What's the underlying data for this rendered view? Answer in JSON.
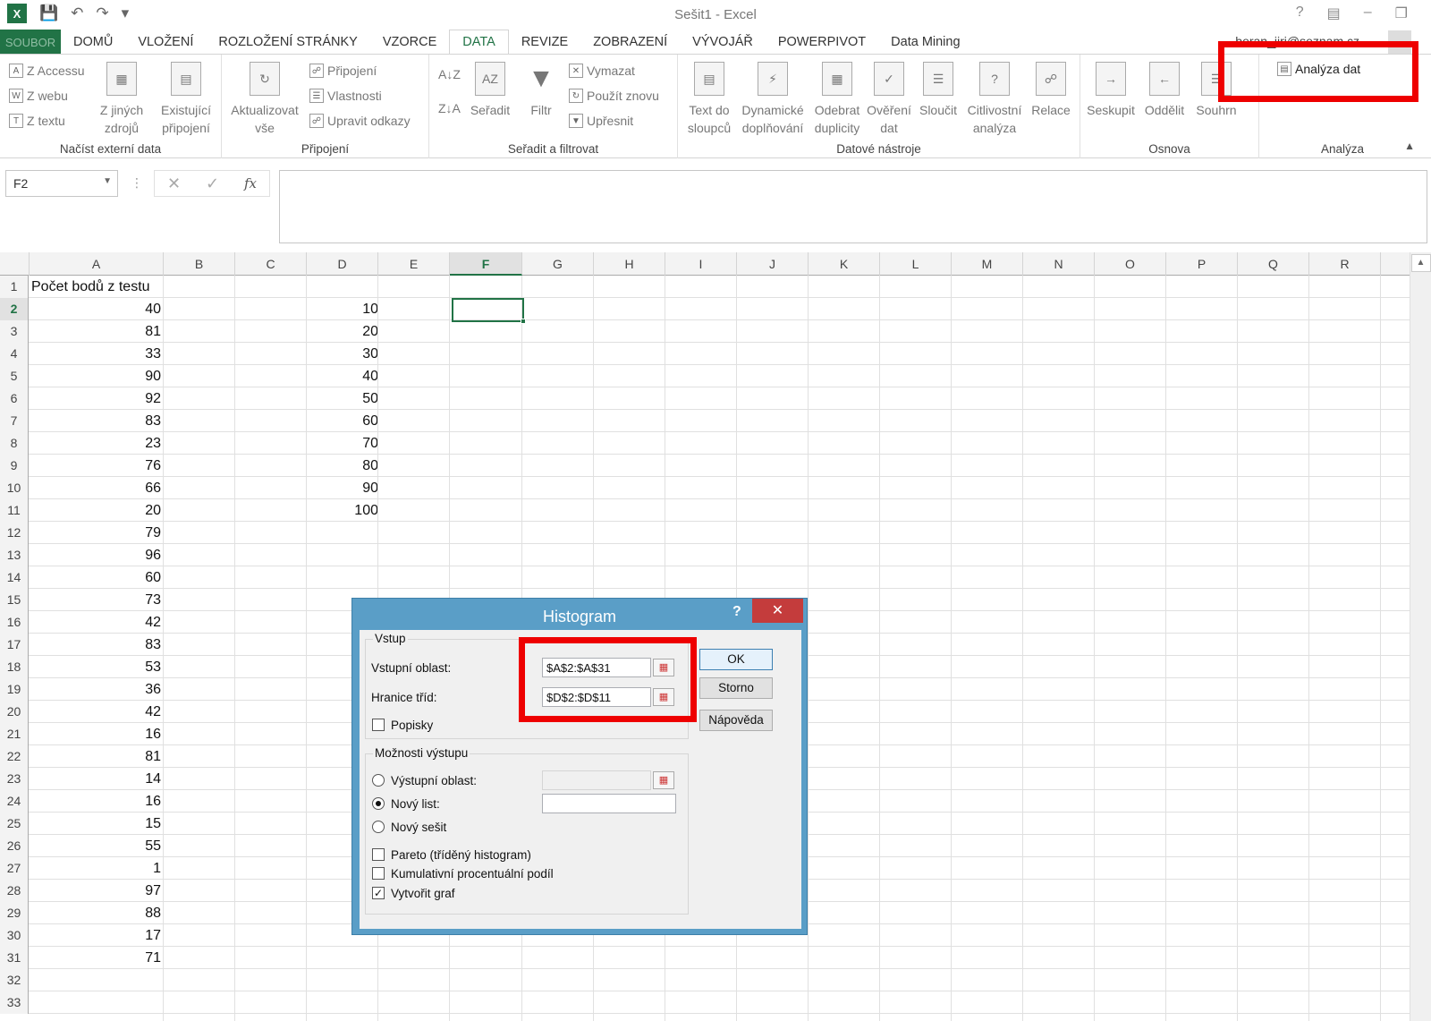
{
  "window": {
    "title": "Sešit1 - Excel",
    "user": "beran_jiri@seznam.cz"
  },
  "tabs": [
    "SOUBOR",
    "DOMŮ",
    "VLOŽENÍ",
    "ROZLOŽENÍ STRÁNKY",
    "VZORCE",
    "DATA",
    "REVIZE",
    "ZOBRAZENÍ",
    "VÝVOJÁŘ",
    "POWERPIVOT",
    "Data Mining"
  ],
  "ribbon": {
    "external": {
      "access": "Z Accessu",
      "web": "Z webu",
      "text": "Z textu",
      "other": "Z jiných",
      "other2": "zdrojů",
      "existing": "Existující",
      "existing2": "připojení",
      "label": "Načíst externí data"
    },
    "connections": {
      "refresh": "Aktualizovat",
      "refresh2": "vše",
      "conn": "Připojení",
      "props": "Vlastnosti",
      "edit": "Upravit odkazy",
      "label": "Připojení"
    },
    "sort": {
      "sort": "Seřadit",
      "filter": "Filtr",
      "clear": "Vymazat",
      "reapply": "Použít znovu",
      "advanced": "Upřesnit",
      "label": "Seřadit a filtrovat"
    },
    "tools": {
      "t2c": "Text do",
      "t2c2": "sloupců",
      "flash": "Dynamické",
      "flash2": "doplňování",
      "dup": "Odebrat",
      "dup2": "duplicity",
      "valid": "Ověření",
      "valid2": "dat",
      "cons": "Sloučit",
      "whatif": "Citlivostní",
      "whatif2": "analýza",
      "rel": "Relace",
      "label": "Datové nástroje"
    },
    "outline": {
      "group": "Seskupit",
      "ungroup": "Oddělit",
      "subtotal": "Souhrn",
      "label": "Osnova"
    },
    "analysis": {
      "data": "Analýza dat",
      "label": "Analýza"
    }
  },
  "namebox": "F2",
  "columns": [
    "A",
    "B",
    "C",
    "D",
    "E",
    "F",
    "G",
    "H",
    "I",
    "J",
    "K",
    "L",
    "M",
    "N",
    "O",
    "P",
    "Q",
    "R"
  ],
  "colA": [
    "Počet bodů z testu",
    "40",
    "81",
    "33",
    "90",
    "92",
    "83",
    "23",
    "76",
    "66",
    "20",
    "79",
    "96",
    "60",
    "73",
    "42",
    "83",
    "53",
    "36",
    "42",
    "16",
    "81",
    "14",
    "16",
    "15",
    "55",
    "1",
    "97",
    "88",
    "17",
    "71",
    "",
    ""
  ],
  "colD": [
    "",
    "10",
    "20",
    "30",
    "40",
    "50",
    "60",
    "70",
    "80",
    "90",
    "100"
  ],
  "dialog": {
    "title": "Histogram",
    "input_group": "Vstup",
    "input_range_label": "Vstupní oblast:",
    "input_range": "$A$2:$A$31",
    "bin_range_label": "Hranice tříd:",
    "bin_range": "$D$2:$D$11",
    "labels": "Popisky",
    "output_group": "Možnosti výstupu",
    "output_range": "Výstupní oblast:",
    "new_sheet": "Nový list:",
    "new_workbook": "Nový sešit",
    "pareto": "Pareto (tříděný histogram)",
    "cumulative": "Kumulativní procentuální podíl",
    "chart": "Vytvořit graf",
    "ok": "OK",
    "cancel": "Storno",
    "help": "Nápověda"
  }
}
